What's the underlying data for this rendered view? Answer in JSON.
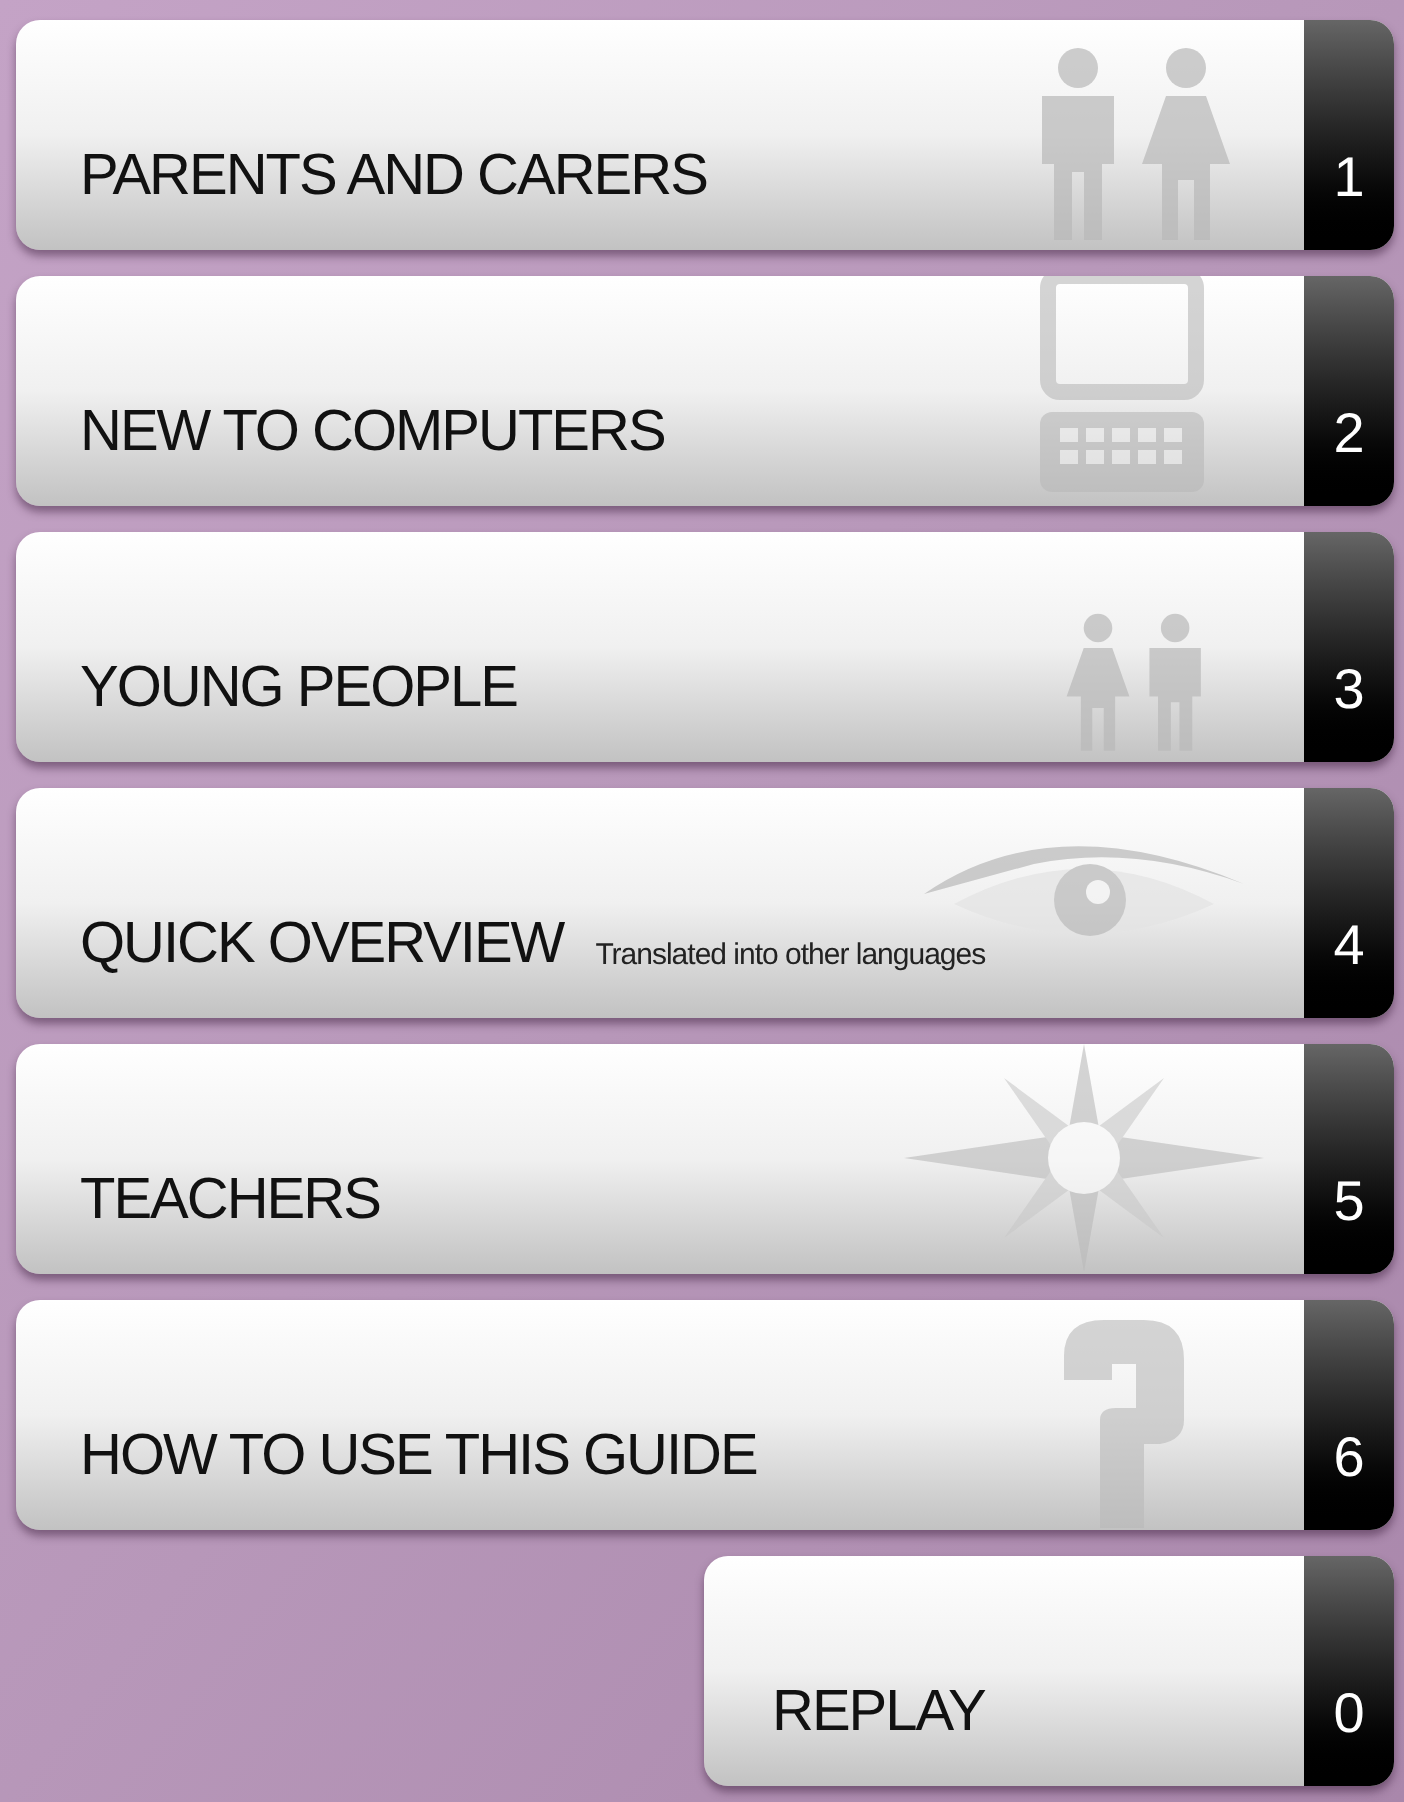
{
  "menu": [
    {
      "label": "PARENTS AND CARERS",
      "number": "1",
      "kind": "adults"
    },
    {
      "label": "NEW TO COMPUTERS",
      "number": "2",
      "kind": "computer"
    },
    {
      "label": "YOUNG PEOPLE",
      "number": "3",
      "kind": "children"
    },
    {
      "label": "QUICK OVERVIEW",
      "subtitle": "Translated into other languages",
      "number": "4",
      "kind": "eye"
    },
    {
      "label": "TEACHERS",
      "number": "5",
      "kind": "star"
    },
    {
      "label": "HOW TO USE THIS GUIDE",
      "number": "6",
      "kind": "question"
    }
  ],
  "replay": {
    "label": "REPLAY",
    "number": "0"
  }
}
